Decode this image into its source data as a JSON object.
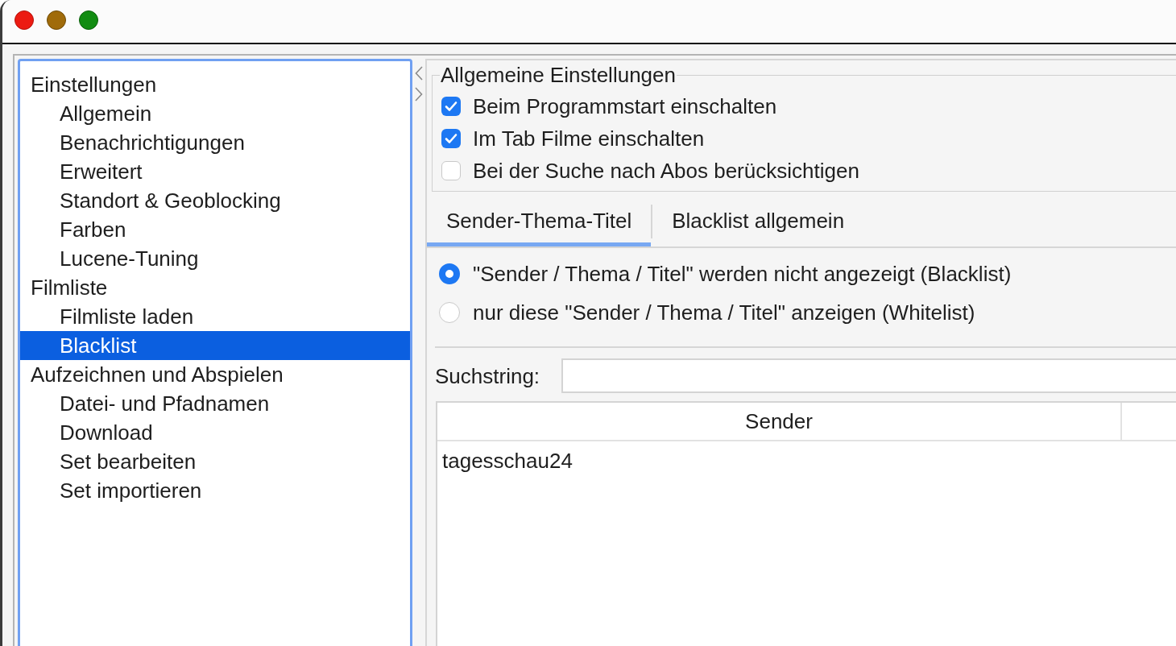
{
  "window": {
    "buttons": [
      {
        "kind": "close",
        "color": "#ec1b12"
      },
      {
        "kind": "minimize",
        "color": "#a06b0a"
      },
      {
        "kind": "zoom",
        "color": "#128c12"
      }
    ]
  },
  "sidebar": {
    "items": [
      {
        "label": "Einstellungen",
        "selected": false,
        "children": [
          {
            "label": "Allgemein",
            "selected": false
          },
          {
            "label": "Benachrichtigungen",
            "selected": false
          },
          {
            "label": "Erweitert",
            "selected": false
          },
          {
            "label": "Standort & Geoblocking",
            "selected": false
          },
          {
            "label": "Farben",
            "selected": false
          },
          {
            "label": "Lucene-Tuning",
            "selected": false
          }
        ]
      },
      {
        "label": "Filmliste",
        "selected": false,
        "children": [
          {
            "label": "Filmliste laden",
            "selected": false
          },
          {
            "label": "Blacklist",
            "selected": true
          }
        ]
      },
      {
        "label": "Aufzeichnen und Abspielen",
        "selected": false,
        "children": [
          {
            "label": "Datei- und Pfadnamen",
            "selected": false
          },
          {
            "label": "Download",
            "selected": false
          },
          {
            "label": "Set bearbeiten",
            "selected": false
          },
          {
            "label": "Set importieren",
            "selected": false
          }
        ]
      }
    ]
  },
  "general_settings": {
    "title": "Allgemeine Einstellungen",
    "checkboxes": [
      {
        "label": "Beim Programmstart einschalten",
        "checked": true
      },
      {
        "label": "Im Tab Filme einschalten",
        "checked": true
      },
      {
        "label": "Bei der Suche nach Abos berücksichtigen",
        "checked": false
      }
    ]
  },
  "tabs": [
    {
      "label": "Sender-Thema-Titel",
      "selected": true
    },
    {
      "label": "Blacklist allgemein",
      "selected": false
    }
  ],
  "list_mode": [
    {
      "label": "\"Sender / Thema / Titel\" werden nicht angezeigt (Blacklist)",
      "selected": true
    },
    {
      "label": "nur diese \"Sender / Thema / Titel\" anzeigen (Whitelist)",
      "selected": false
    }
  ],
  "search": {
    "label": "Suchstring:"
  },
  "table": {
    "columns": [
      "Sender"
    ],
    "rows": [
      [
        "tagesschau24"
      ]
    ]
  }
}
